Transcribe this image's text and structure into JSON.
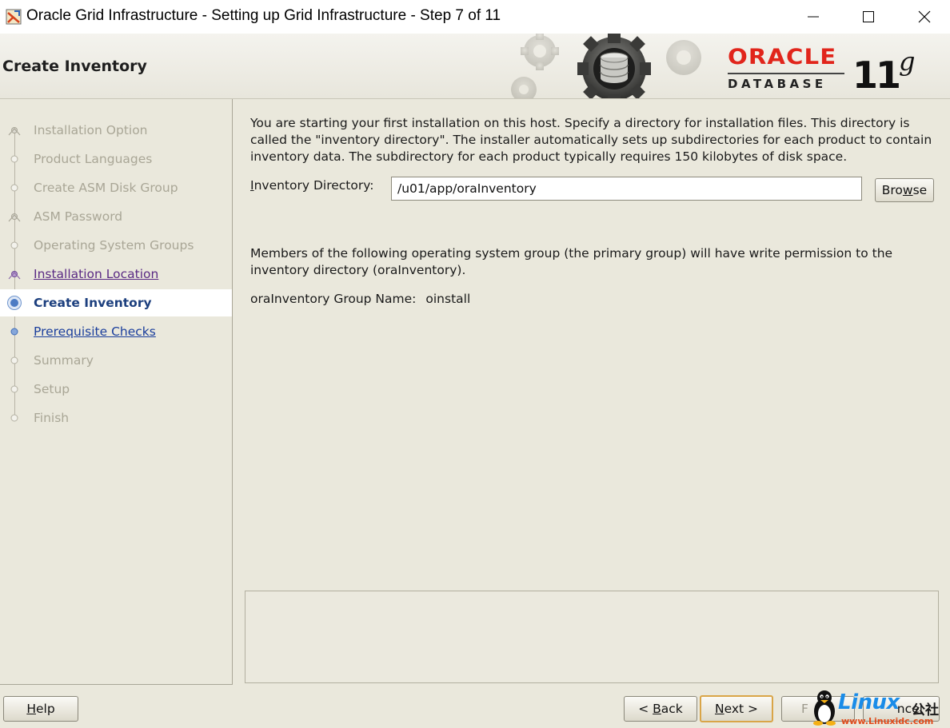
{
  "window": {
    "title": "Oracle Grid Infrastructure - Setting up Grid Infrastructure - Step 7 of 11",
    "icons": [
      "installer-app-icon",
      "minimize-icon",
      "maximize-icon",
      "close-icon"
    ]
  },
  "header": {
    "page_title": "Create Inventory",
    "logo": {
      "brand": "ORACLE",
      "product": "DATABASE",
      "version_number": "11",
      "version_letter": "g",
      "brand_color": "#e1251b"
    }
  },
  "steps": [
    {
      "label": "Installation Option",
      "state": "done"
    },
    {
      "label": "Product Languages",
      "state": "future"
    },
    {
      "label": "Create ASM Disk Group",
      "state": "future"
    },
    {
      "label": "ASM Password",
      "state": "done"
    },
    {
      "label": "Operating System Groups",
      "state": "future"
    },
    {
      "label": "Installation Location",
      "state": "visited"
    },
    {
      "label": "Create Inventory",
      "state": "current"
    },
    {
      "label": "Prerequisite Checks",
      "state": "link"
    },
    {
      "label": "Summary",
      "state": "future"
    },
    {
      "label": "Setup",
      "state": "future"
    },
    {
      "label": "Finish",
      "state": "future"
    }
  ],
  "content": {
    "intro": "You are starting your first installation on this host. Specify a directory for installation files. This directory is called the \"inventory directory\". The installer automatically sets up subdirectories for each product to contain inventory data. The subdirectory for each product typically requires 150 kilobytes of disk space.",
    "inventory_label_mnemonic": "I",
    "inventory_label_rest": "nventory Directory:",
    "inventory_value": "/u01/app/oraInventory",
    "browse_mnemonic": "w",
    "browse_pre": "Bro",
    "browse_post": "se",
    "members_text": "Members of the following operating system group (the primary group) will have write permission to the inventory directory (oraInventory).",
    "group_label": "oraInventory Group Name:",
    "group_value": "oinstall"
  },
  "buttons": {
    "help_mnemonic": "H",
    "help_rest": "elp",
    "back_pre": "< ",
    "back_mnemonic": "B",
    "back_rest": "ack",
    "next_mnemonic": "N",
    "next_rest": "ext >",
    "install_partial": "F",
    "cancel_partial": "ncel"
  },
  "watermark": {
    "text": "Linux",
    "sub": "www.Linuxidc.com",
    "cjk": "公社"
  }
}
